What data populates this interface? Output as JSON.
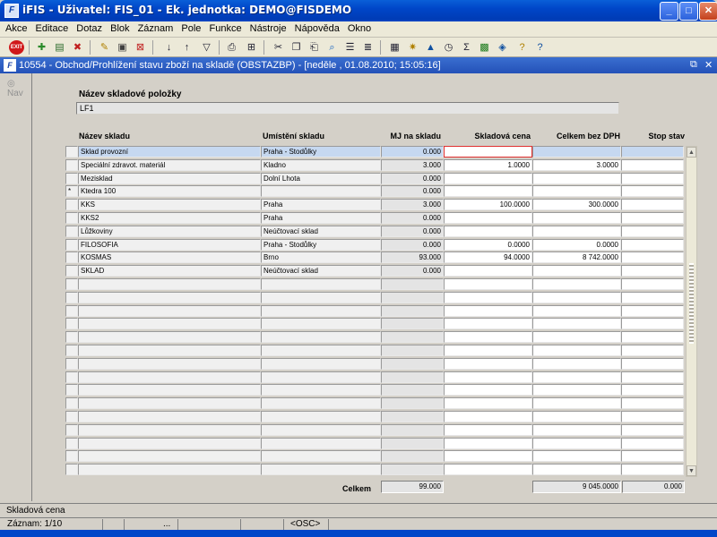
{
  "window": {
    "title": "iFIS - Uživatel: FIS_01 - Ek. jednotka: DEMO@FISDEMO",
    "icon_letter": "F",
    "controls": {
      "minimize": "_",
      "maximize": "□",
      "close": "✕"
    }
  },
  "menu": [
    "Akce",
    "Editace",
    "Dotaz",
    "Blok",
    "Záznam",
    "Pole",
    "Funkce",
    "Nástroje",
    "Nápověda",
    "Okno"
  ],
  "toolbar": {
    "exit_label": "EXIT",
    "icons": [
      "exit-icon",
      "save-icon",
      "print-icon",
      "delete-icon",
      "query-icon",
      "enter-query-icon",
      "cancel-query-icon",
      "sort-asc-icon",
      "sort-desc-icon",
      "filter-icon",
      "print-preview-icon",
      "print2-icon",
      "cut-icon",
      "copy-icon",
      "paste-icon",
      "find-icon",
      "list-icon",
      "list2-icon",
      "calculator-icon",
      "star-icon",
      "triangle-icon",
      "clock-icon",
      "sum-icon",
      "excel-icon",
      "export-icon",
      "help-icon",
      "question-icon"
    ]
  },
  "subwindow": {
    "title": "10554 - Obchod/Prohlížení stavu zboží na skladě (OBSTAZBP) - [neděle , 01.08.2010; 15:05:16]",
    "icon_letter": "F",
    "restore": "⧉",
    "close": "✕"
  },
  "nav": {
    "label": "Nav"
  },
  "item": {
    "label": "Název skladové položky",
    "value": "LF1"
  },
  "table": {
    "headers": {
      "name": "Název skladu",
      "location": "Umístění skladu",
      "mj": "MJ na skladu",
      "price": "Skladová cena",
      "total": "Celkem bez DPH",
      "stop": "Stop stav"
    },
    "rows": [
      {
        "indicator": "",
        "name": "Sklad provozní",
        "location": "Praha - Stodůlky",
        "mj": "0.000",
        "price": "",
        "total": "",
        "stop": ""
      },
      {
        "indicator": "",
        "name": "Speciální zdravot. materiál",
        "location": "Kladno",
        "mj": "3.000",
        "price": "1.0000",
        "total": "3.0000",
        "stop": ""
      },
      {
        "indicator": "",
        "name": "Mezisklad",
        "location": "Dolní Lhota",
        "mj": "0.000",
        "price": "",
        "total": "",
        "stop": ""
      },
      {
        "indicator": "*",
        "name": "Ktedra 100",
        "location": "",
        "mj": "0.000",
        "price": "",
        "total": "",
        "stop": ""
      },
      {
        "indicator": "",
        "name": "KKS",
        "location": "Praha",
        "mj": "3.000",
        "price": "100.0000",
        "total": "300.0000",
        "stop": ""
      },
      {
        "indicator": "",
        "name": "KKS2",
        "location": "Praha",
        "mj": "0.000",
        "price": "",
        "total": "",
        "stop": ""
      },
      {
        "indicator": "",
        "name": "Lůžkoviny",
        "location": "Neúčtovací sklad",
        "mj": "0.000",
        "price": "",
        "total": "",
        "stop": ""
      },
      {
        "indicator": "",
        "name": "FILOSOFIA",
        "location": "Praha - Stodůlky",
        "mj": "0.000",
        "price": "0.0000",
        "total": "0.0000",
        "stop": ""
      },
      {
        "indicator": "",
        "name": "KOSMAS",
        "location": "Brno",
        "mj": "93.000",
        "price": "94.0000",
        "total": "8 742.0000",
        "stop": ""
      },
      {
        "indicator": "",
        "name": "SKLAD",
        "location": "Neúčtovací sklad",
        "mj": "0.000",
        "price": "",
        "total": "",
        "stop": ""
      }
    ],
    "empty_rows": 15
  },
  "totals": {
    "label": "Celkem",
    "mj": "99.000",
    "total": "9 045.0000",
    "stop": "0.000"
  },
  "status": {
    "field_hint": "Skladová cena",
    "record": "Záznam: 1/10",
    "ellipsis": "...",
    "mode": "<OSC>"
  }
}
